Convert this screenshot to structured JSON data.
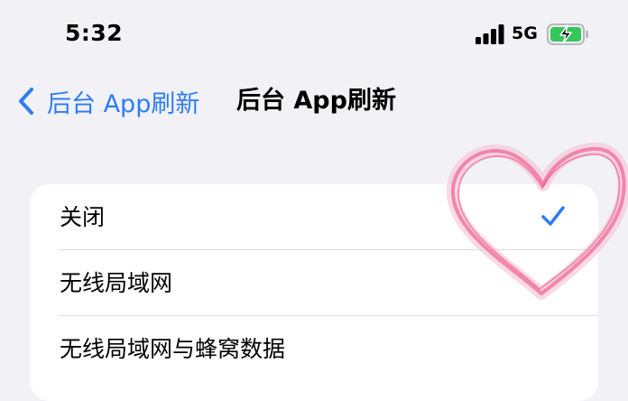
{
  "status_bar": {
    "time": "5:32",
    "network": "5G",
    "icons": [
      "signal-bars-icon",
      "battery-charging-icon"
    ],
    "battery_color": "#34c759"
  },
  "nav": {
    "back_label": "后台 App刷新",
    "title": "后台 App刷新",
    "accent_color": "#2f7cf6"
  },
  "options": [
    {
      "label": "关闭",
      "selected": true
    },
    {
      "label": "无线局域网",
      "selected": false
    },
    {
      "label": "无线局域网与蜂窝数据",
      "selected": false
    }
  ],
  "overlay": {
    "icon": "heart-sticker-icon",
    "color": "#f48fb1"
  }
}
